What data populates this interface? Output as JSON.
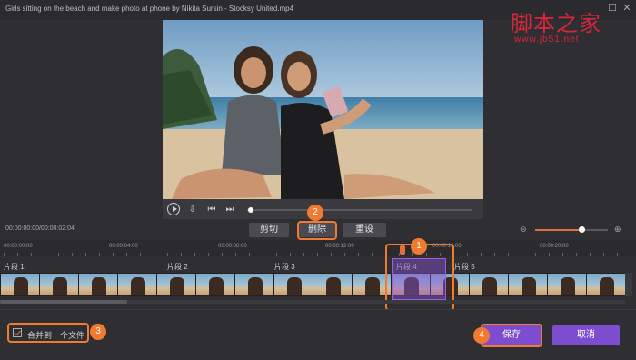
{
  "window": {
    "title": "Girls sitting on the beach and make photo at phone by Nikita Sursin - Stocksy United.mp4",
    "watermark": "脚本之家",
    "watermark_url": "www.jb51.net"
  },
  "player": {
    "timecode": "00:00:00:00/00:00:02:04"
  },
  "toolbar": {
    "cut_label": "剪切",
    "delete_label": "删除",
    "reset_label": "重设"
  },
  "ruler": [
    "00:00:00:00",
    "00:00:04:00",
    "00:00:08:00",
    "00:00:12:00",
    "00:00:16:00",
    "00:00:20:00"
  ],
  "segments": [
    "片段 1",
    "片段 2",
    "片段 3",
    "片段 4",
    "片段 5"
  ],
  "footer": {
    "merge_label": "合并到一个文件",
    "save_label": "保存",
    "cancel_label": "取消"
  },
  "annotations": [
    "1",
    "2",
    "3",
    "4"
  ],
  "colors": {
    "accent": "#f07a30",
    "button_purple": "#7c4dcf",
    "background": "#2f2f33"
  }
}
